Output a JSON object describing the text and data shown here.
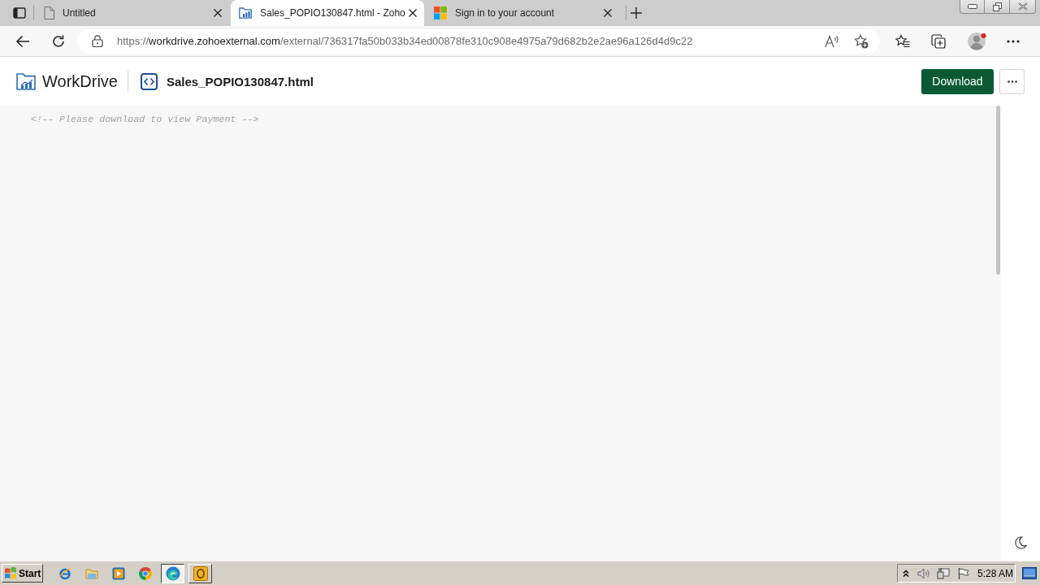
{
  "browser": {
    "tabs": [
      {
        "title": "Untitled",
        "selected": false
      },
      {
        "title": "Sales_POPIO130847.html - Zoho",
        "selected": true
      },
      {
        "title": "Sign in to your account",
        "selected": false
      }
    ],
    "address_bar": {
      "scheme": "https://",
      "host": "workdrive.zohoexternal.com",
      "path": "/external/736317fa50b033b34ed00878fe310c908e4975a79d682b2e2ae96a126d4d9c22"
    }
  },
  "header": {
    "app_name": "WorkDrive",
    "file_name": "Sales_POPIO130847.html",
    "download_button": "Download"
  },
  "preview": {
    "text": "<!-- Please download to view Payment -->"
  },
  "taskbar": {
    "start_button": "Start",
    "windows": [
      {
        "selected": true
      },
      {
        "selected": false
      }
    ],
    "clock": "5:28 AM"
  }
}
